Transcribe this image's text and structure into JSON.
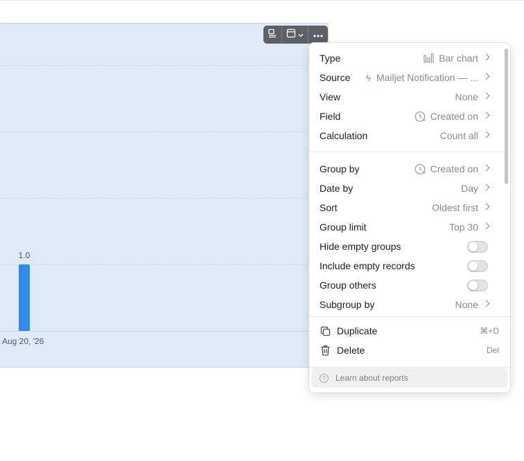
{
  "chart_data": {
    "type": "bar",
    "categories": [
      "Aug 20, '26"
    ],
    "values": [
      1.0
    ],
    "data_labels": [
      "1.0"
    ],
    "grid": true
  },
  "toolbar": {
    "buttons": [
      "display-icon",
      "layout-icon",
      "more-icon"
    ]
  },
  "menu": {
    "settings": [
      {
        "label": "Type",
        "value": "Bar chart",
        "icon": "bar-chart-icon"
      },
      {
        "label": "Source",
        "value": "Mailjet Notification — ...",
        "icon": "bolt-icon"
      },
      {
        "label": "View",
        "value": "None"
      },
      {
        "label": "Field",
        "value": "Created on",
        "icon": "clock-icon"
      },
      {
        "label": "Calculation",
        "value": "Count all"
      }
    ],
    "grouping": [
      {
        "label": "Group by",
        "value": "Created on",
        "icon": "clock-icon"
      },
      {
        "label": "Date by",
        "value": "Day"
      },
      {
        "label": "Sort",
        "value": "Oldest first"
      },
      {
        "label": "Group limit",
        "value": "Top 30"
      }
    ],
    "toggles": [
      {
        "label": "Hide empty groups",
        "on": false
      },
      {
        "label": "Include empty records",
        "on": false
      },
      {
        "label": "Group others",
        "on": false
      }
    ],
    "subgroup": {
      "label": "Subgroup by",
      "value": "None"
    },
    "actions": [
      {
        "label": "Duplicate",
        "shortcut": "⌘+D",
        "icon": "duplicate-icon"
      },
      {
        "label": "Delete",
        "shortcut": "Del",
        "icon": "trash-icon"
      }
    ],
    "footer": "Learn about reports"
  }
}
